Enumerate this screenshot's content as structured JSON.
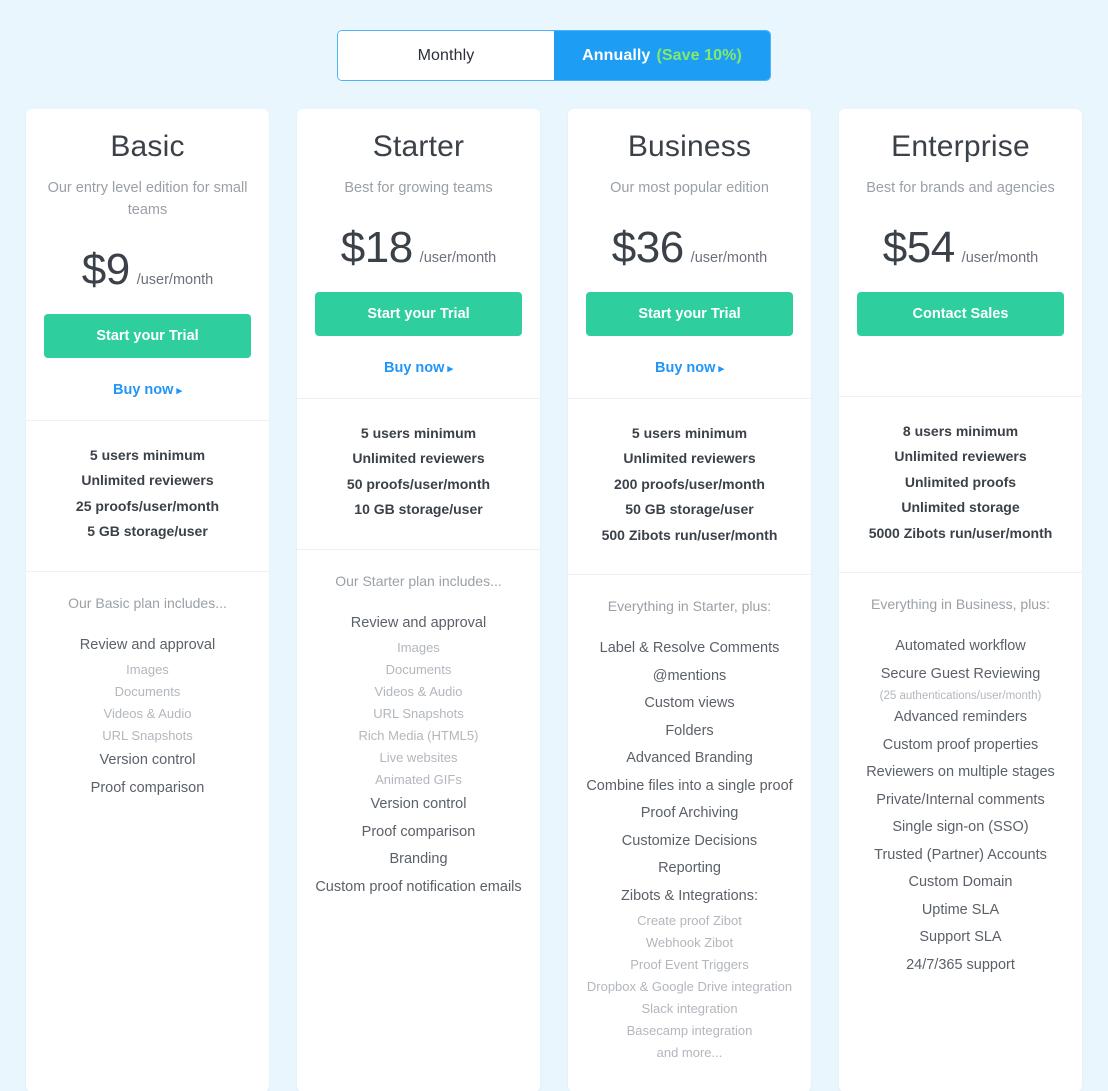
{
  "billing_toggle": {
    "monthly_label": "Monthly",
    "annually_label": "Annually",
    "annually_save_label": "(Save 10%)",
    "active": "Annually",
    "active_color": "#1e9df5",
    "save_color": "#85e96a"
  },
  "theme": {
    "page_background": "#eaf6fd",
    "card_background": "#ffffff",
    "cta_color": "#2ece9f",
    "link_color": "#2196f8",
    "heading_color": "#3b4148",
    "muted_color": "#9aa0a6"
  },
  "plans": [
    {
      "name": "Basic",
      "tagline": "Our entry level edition for small teams",
      "price": "$9",
      "price_unit": "/user/month",
      "cta_label": "Start your Trial",
      "buy_now_label": "Buy now",
      "buy_now_caret": "▸",
      "has_buy_now": true,
      "specs": [
        "5 users minimum",
        "Unlimited reviewers",
        "25 proofs/user/month",
        "5 GB storage/user"
      ],
      "features_heading": "Our Basic plan includes...",
      "features": [
        {
          "label": "Review and approval",
          "style": "main"
        },
        {
          "label": "Images",
          "style": "sub"
        },
        {
          "label": "Documents",
          "style": "sub"
        },
        {
          "label": "Videos & Audio",
          "style": "sub"
        },
        {
          "label": "URL Snapshots",
          "style": "sub"
        },
        {
          "label": "Version control",
          "style": "main"
        },
        {
          "label": "Proof comparison",
          "style": "main"
        }
      ]
    },
    {
      "name": "Starter",
      "tagline": "Best for growing teams",
      "price": "$18",
      "price_unit": "/user/month",
      "cta_label": "Start your Trial",
      "buy_now_label": "Buy now",
      "buy_now_caret": "▸",
      "has_buy_now": true,
      "specs": [
        "5 users minimum",
        "Unlimited reviewers",
        "50 proofs/user/month",
        "10 GB storage/user"
      ],
      "features_heading": "Our Starter plan includes...",
      "features": [
        {
          "label": "Review and approval",
          "style": "main"
        },
        {
          "label": "Images",
          "style": "sub"
        },
        {
          "label": "Documents",
          "style": "sub"
        },
        {
          "label": "Videos & Audio",
          "style": "sub"
        },
        {
          "label": "URL Snapshots",
          "style": "sub"
        },
        {
          "label": "Rich Media (HTML5)",
          "style": "sub"
        },
        {
          "label": "Live websites",
          "style": "sub"
        },
        {
          "label": "Animated GIFs",
          "style": "sub"
        },
        {
          "label": "Version control",
          "style": "main"
        },
        {
          "label": "Proof comparison",
          "style": "main"
        },
        {
          "label": "Branding",
          "style": "main"
        },
        {
          "label": "Custom proof notification emails",
          "style": "main"
        }
      ]
    },
    {
      "name": "Business",
      "tagline": "Our most popular edition",
      "price": "$36",
      "price_unit": "/user/month",
      "cta_label": "Start your Trial",
      "buy_now_label": "Buy now",
      "buy_now_caret": "▸",
      "has_buy_now": true,
      "specs": [
        "5 users minimum",
        "Unlimited reviewers",
        "200 proofs/user/month",
        "50 GB storage/user",
        "500 Zibots run/user/month"
      ],
      "features_heading": "Everything in Starter, plus:",
      "features": [
        {
          "label": "Label & Resolve Comments",
          "style": "main"
        },
        {
          "label": "@mentions",
          "style": "main"
        },
        {
          "label": "Custom views",
          "style": "main"
        },
        {
          "label": "Folders",
          "style": "main"
        },
        {
          "label": "Advanced Branding",
          "style": "main"
        },
        {
          "label": "Combine files into a single proof",
          "style": "main"
        },
        {
          "label": "Proof Archiving",
          "style": "main"
        },
        {
          "label": "Customize Decisions",
          "style": "main"
        },
        {
          "label": "Reporting",
          "style": "main"
        },
        {
          "label": "Zibots & Integrations:",
          "style": "main"
        },
        {
          "label": "Create proof Zibot",
          "style": "sub"
        },
        {
          "label": "Webhook Zibot",
          "style": "sub"
        },
        {
          "label": "Proof Event Triggers",
          "style": "sub"
        },
        {
          "label": "Dropbox & Google Drive integration",
          "style": "sub"
        },
        {
          "label": "Slack integration",
          "style": "sub"
        },
        {
          "label": "Basecamp integration",
          "style": "sub"
        },
        {
          "label": "and more...",
          "style": "sub"
        }
      ]
    },
    {
      "name": "Enterprise",
      "tagline": "Best for brands and agencies",
      "price": "$54",
      "price_unit": "/user/month",
      "cta_label": "Contact Sales",
      "buy_now_label": "",
      "buy_now_caret": "",
      "has_buy_now": false,
      "specs": [
        "8 users minimum",
        "Unlimited reviewers",
        "Unlimited proofs",
        "Unlimited storage",
        "5000 Zibots run/user/month"
      ],
      "features_heading": "Everything in Business, plus:",
      "features": [
        {
          "label": "Automated workflow",
          "style": "main"
        },
        {
          "label": "Secure Guest Reviewing",
          "style": "main"
        },
        {
          "label": "(25 authentications/user/month)",
          "style": "note"
        },
        {
          "label": "Advanced reminders",
          "style": "main"
        },
        {
          "label": "Custom proof properties",
          "style": "main"
        },
        {
          "label": "Reviewers on multiple stages",
          "style": "main"
        },
        {
          "label": "Private/Internal comments",
          "style": "main"
        },
        {
          "label": "Single sign-on (SSO)",
          "style": "main"
        },
        {
          "label": "Trusted (Partner) Accounts",
          "style": "main"
        },
        {
          "label": "Custom Domain",
          "style": "main"
        },
        {
          "label": "Uptime SLA",
          "style": "main"
        },
        {
          "label": "Support SLA",
          "style": "main"
        },
        {
          "label": "24/7/365 support",
          "style": "main"
        }
      ]
    }
  ]
}
